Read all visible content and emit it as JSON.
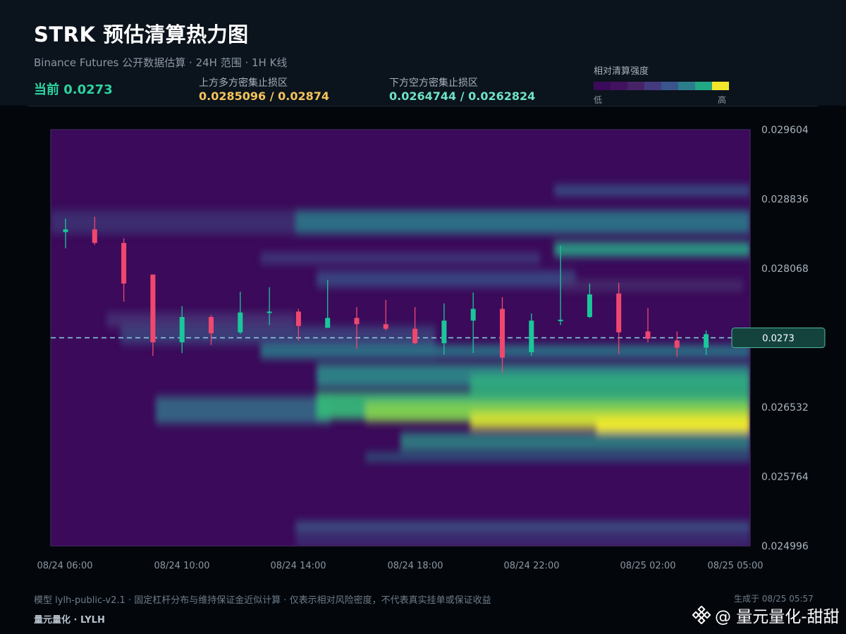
{
  "header": {
    "title": "STRK 预估清算热力图",
    "subtitle": "Binance Futures 公开数据估算 · 24H 范围 · 1H K线",
    "current": "当前 0.0273",
    "upper_zone_label": "上方多方密集止损区",
    "upper_zone_value": "0.0285096 / 0.02874",
    "lower_zone_label": "下方空方密集止损区",
    "lower_zone_value": "0.0264744 / 0.0262824",
    "colorbar": {
      "title": "相对清算强度",
      "low": "低",
      "high": "高",
      "colors": [
        "#3b0a5a",
        "#41135f",
        "#452366",
        "#443a80",
        "#39558c",
        "#2b7d8c",
        "#22a784",
        "#f0e72a"
      ]
    }
  },
  "chart_data": {
    "type": "heatmap",
    "overlay": "candlestick",
    "yticks": [
      "0.029604",
      "0.028836",
      "0.028068",
      "0.027300",
      "0.026532",
      "0.025764",
      "0.024996"
    ],
    "ylim": [
      0.024996,
      0.029604
    ],
    "xticks": [
      "08/24 06:00",
      "08/24 10:00",
      "08/24 14:00",
      "08/24 18:00",
      "08/24 22:00",
      "08/25 02:00",
      "08/25 05:00"
    ],
    "current_price": 0.0273,
    "current_price_label": "0.0273",
    "up_color": "#19c79a",
    "down_color": "#f0476f",
    "candles": [
      {
        "time": "08/24 06:00",
        "open": 0.02847,
        "high": 0.02862,
        "low": 0.02829,
        "close": 0.0285
      },
      {
        "time": "08/24 07:00",
        "open": 0.0285,
        "high": 0.02864,
        "low": 0.02833,
        "close": 0.02835
      },
      {
        "time": "08/24 08:00",
        "open": 0.02835,
        "high": 0.0284,
        "low": 0.0277,
        "close": 0.0279
      },
      {
        "time": "08/24 09:00",
        "open": 0.028,
        "high": 0.028,
        "low": 0.0271,
        "close": 0.02725
      },
      {
        "time": "08/24 10:00",
        "open": 0.02725,
        "high": 0.02765,
        "low": 0.02713,
        "close": 0.02753
      },
      {
        "time": "08/24 11:00",
        "open": 0.02753,
        "high": 0.02755,
        "low": 0.02722,
        "close": 0.02735
      },
      {
        "time": "08/24 12:00",
        "open": 0.02736,
        "high": 0.02781,
        "low": 0.02734,
        "close": 0.02758
      },
      {
        "time": "08/24 13:00",
        "open": 0.02758,
        "high": 0.02786,
        "low": 0.02744,
        "close": 0.02759
      },
      {
        "time": "08/24 14:00",
        "open": 0.02759,
        "high": 0.02762,
        "low": 0.02727,
        "close": 0.02743
      },
      {
        "time": "08/24 15:00",
        "open": 0.02741,
        "high": 0.02794,
        "low": 0.02741,
        "close": 0.02752
      },
      {
        "time": "08/24 16:00",
        "open": 0.02752,
        "high": 0.02764,
        "low": 0.02718,
        "close": 0.02745
      },
      {
        "time": "08/24 17:00",
        "open": 0.02745,
        "high": 0.02772,
        "low": 0.02738,
        "close": 0.0274
      },
      {
        "time": "08/24 18:00",
        "open": 0.0274,
        "high": 0.02764,
        "low": 0.02723,
        "close": 0.02724
      },
      {
        "time": "08/24 19:00",
        "open": 0.02724,
        "high": 0.02768,
        "low": 0.02711,
        "close": 0.02749
      },
      {
        "time": "08/24 20:00",
        "open": 0.02749,
        "high": 0.0278,
        "low": 0.02713,
        "close": 0.02762
      },
      {
        "time": "08/24 21:00",
        "open": 0.02762,
        "high": 0.02775,
        "low": 0.02691,
        "close": 0.02708
      },
      {
        "time": "08/24 22:00",
        "open": 0.02714,
        "high": 0.02757,
        "low": 0.0271,
        "close": 0.02749
      },
      {
        "time": "08/24 23:00",
        "open": 0.02749,
        "high": 0.02832,
        "low": 0.02744,
        "close": 0.0275
      },
      {
        "time": "08/25 00:00",
        "open": 0.02753,
        "high": 0.0279,
        "low": 0.02752,
        "close": 0.02778
      },
      {
        "time": "08/25 01:00",
        "open": 0.02779,
        "high": 0.02791,
        "low": 0.02712,
        "close": 0.02736
      },
      {
        "time": "08/25 02:00",
        "open": 0.02737,
        "high": 0.02763,
        "low": 0.02725,
        "close": 0.02729
      },
      {
        "time": "08/25 03:00",
        "open": 0.02727,
        "high": 0.02737,
        "low": 0.02709,
        "close": 0.02719
      },
      {
        "time": "08/25 04:00",
        "open": 0.02719,
        "high": 0.02738,
        "low": 0.02711,
        "close": 0.02734
      }
    ]
  },
  "footer": {
    "note": "模型 lylh-public-v2.1 · 固定杠杆分布与维持保证金近似计算 · 仅表示相对风险密度，不代表真实挂单或保证收益",
    "brand": "量元量化 · LYLH",
    "generated": "生成于 08/25 05:57",
    "watermark": "@ 量元量化-甜甜"
  }
}
